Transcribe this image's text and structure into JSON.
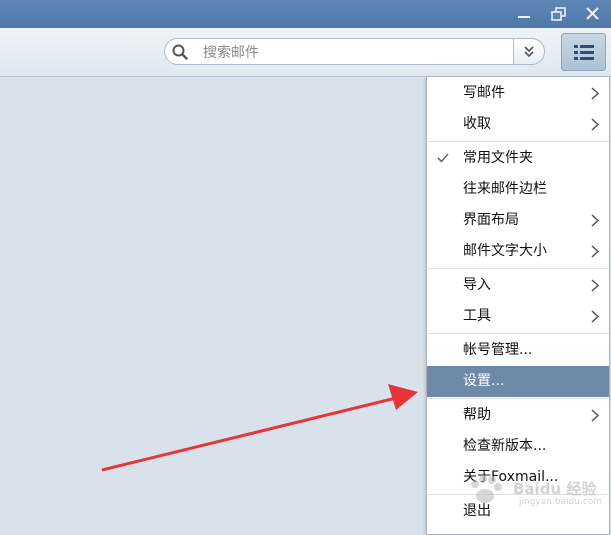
{
  "window": {
    "minimize_icon": "minimize-icon",
    "restore_icon": "restore-icon",
    "close_icon": "close-icon"
  },
  "search": {
    "placeholder": "搜索邮件",
    "value": ""
  },
  "menu": {
    "items": [
      {
        "label": "写邮件",
        "submenu": true
      },
      {
        "label": "收取",
        "submenu": true
      },
      {
        "label": "常用文件夹",
        "checked": true
      },
      {
        "label": "往来邮件边栏"
      },
      {
        "label": "界面布局",
        "submenu": true
      },
      {
        "label": "邮件文字大小",
        "submenu": true
      },
      {
        "label": "导入",
        "submenu": true
      },
      {
        "label": "工具",
        "submenu": true
      },
      {
        "label": "帐号管理..."
      },
      {
        "label": "设置...",
        "selected": true
      },
      {
        "label": "帮助",
        "submenu": true
      },
      {
        "label": "检查新版本..."
      },
      {
        "label": "关于Foxmail..."
      },
      {
        "label": "退出"
      }
    ]
  },
  "watermark": {
    "text": "Baidu 经验",
    "sub": "jingyan.baidu.com"
  },
  "colors": {
    "title_bar": "#5a82b2",
    "selected_item": "#6e8aa6",
    "arrow": "#e8353a",
    "background": "#d9e2ea"
  }
}
